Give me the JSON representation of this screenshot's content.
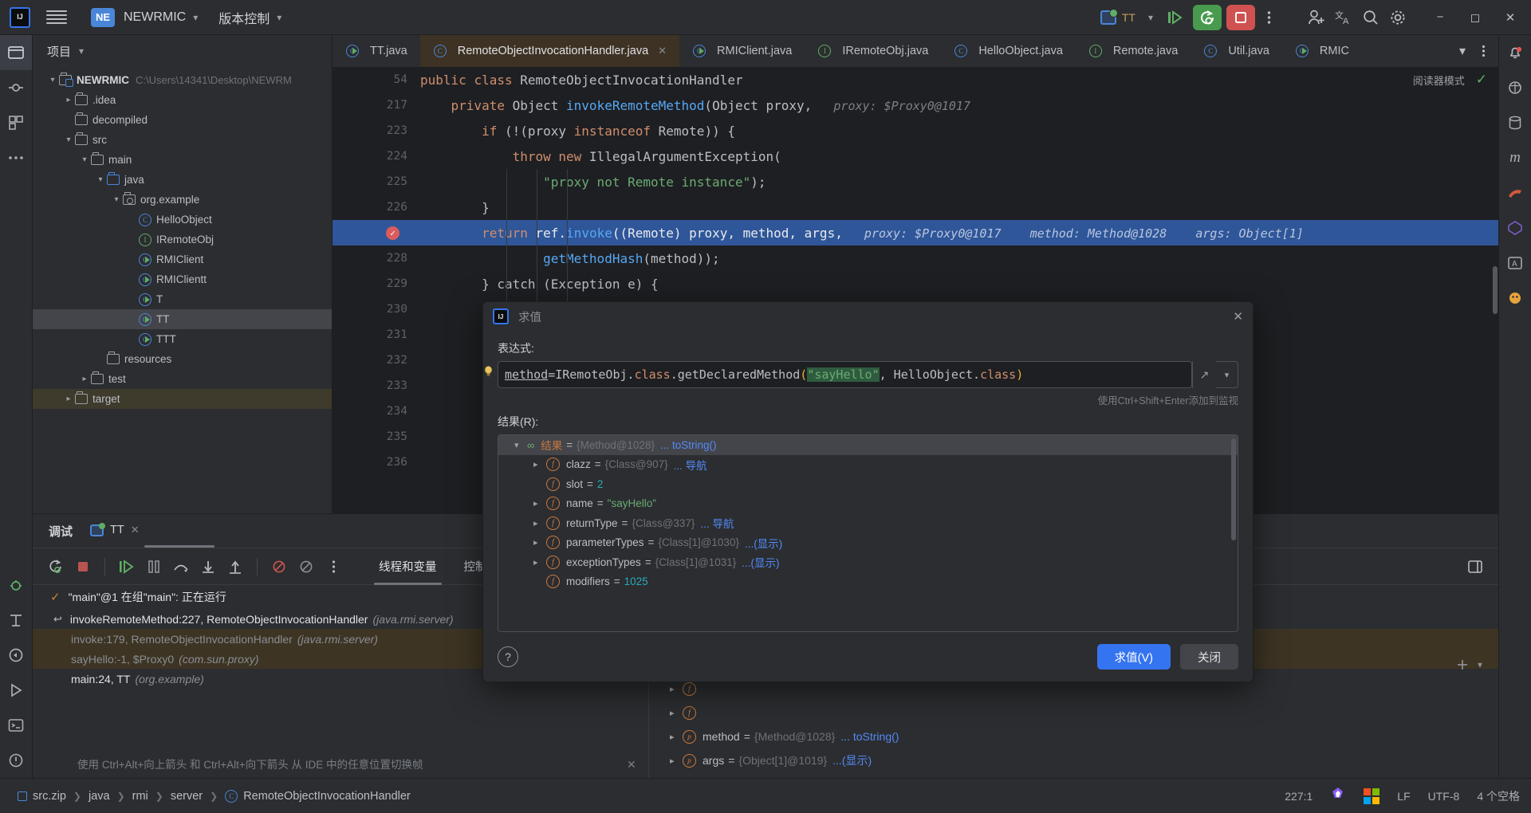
{
  "titlebar": {
    "logo": "IJ",
    "menu_icon": "hamburger-icon",
    "project_badge": "NE",
    "project_name": "NEWRMIC",
    "vcs_label": "版本控制",
    "run_config": "TT",
    "icons": [
      "run-icon",
      "debug-icon",
      "stop-icon",
      "more-icon",
      "add-user-icon",
      "translate-icon",
      "search-icon",
      "settings-icon"
    ],
    "window_buttons": [
      "minimize",
      "maximize",
      "close"
    ]
  },
  "project_panel": {
    "title": "项目",
    "tree": [
      {
        "depth": 0,
        "arrow": "v",
        "icon": "module-folder-icon",
        "label": "NEWRMIC",
        "bold": true,
        "path": "C:\\Users\\14341\\Desktop\\NEWRM",
        "state": "normal"
      },
      {
        "depth": 1,
        "arrow": ">",
        "icon": "folder-icon",
        "label": ".idea",
        "state": "normal"
      },
      {
        "depth": 1,
        "arrow": "",
        "icon": "folder-icon",
        "label": "decompiled",
        "state": "normal"
      },
      {
        "depth": 1,
        "arrow": "v",
        "icon": "folder-icon",
        "label": "src",
        "state": "normal"
      },
      {
        "depth": 2,
        "arrow": "v",
        "icon": "folder-icon",
        "label": "main",
        "state": "normal"
      },
      {
        "depth": 3,
        "arrow": "v",
        "icon": "source-folder-icon",
        "label": "java",
        "state": "normal"
      },
      {
        "depth": 4,
        "arrow": "v",
        "icon": "package-icon",
        "label": "org.example",
        "state": "normal"
      },
      {
        "depth": 5,
        "arrow": "",
        "icon": "class-icon",
        "label": "HelloObject",
        "state": "normal"
      },
      {
        "depth": 5,
        "arrow": "",
        "icon": "interface-icon",
        "label": "IRemoteObj",
        "state": "normal"
      },
      {
        "depth": 5,
        "arrow": "",
        "icon": "runnable-class-icon",
        "label": "RMIClient",
        "state": "normal"
      },
      {
        "depth": 5,
        "arrow": "",
        "icon": "runnable-class-icon",
        "label": "RMIClientt",
        "state": "normal"
      },
      {
        "depth": 5,
        "arrow": "",
        "icon": "runnable-class-icon",
        "label": "T",
        "state": "normal"
      },
      {
        "depth": 5,
        "arrow": "",
        "icon": "runnable-class-icon",
        "label": "TT",
        "state": "selected"
      },
      {
        "depth": 5,
        "arrow": "",
        "icon": "runnable-class-icon",
        "label": "TTT",
        "state": "normal"
      },
      {
        "depth": 3,
        "arrow": "",
        "icon": "folder-icon",
        "label": "resources",
        "state": "normal"
      },
      {
        "depth": 2,
        "arrow": ">",
        "icon": "folder-icon",
        "label": "test",
        "state": "normal"
      },
      {
        "depth": 1,
        "arrow": ">",
        "icon": "folder-icon",
        "label": "target",
        "state": "highlight"
      }
    ]
  },
  "editor": {
    "tabs": [
      {
        "label": "TT.java",
        "icon": "runnable-class-icon",
        "active": false,
        "closable": false
      },
      {
        "label": "RemoteObjectInvocationHandler.java",
        "icon": "class-icon",
        "active": true,
        "closable": true
      },
      {
        "label": "RMIClient.java",
        "icon": "runnable-class-icon",
        "active": false,
        "closable": false
      },
      {
        "label": "IRemoteObj.java",
        "icon": "interface-icon",
        "active": false,
        "closable": false
      },
      {
        "label": "HelloObject.java",
        "icon": "class-icon",
        "active": false,
        "closable": false
      },
      {
        "label": "Remote.java",
        "icon": "interface-icon",
        "active": false,
        "closable": false
      },
      {
        "label": "Util.java",
        "icon": "class-icon",
        "active": false,
        "closable": false
      },
      {
        "label": "RMIC",
        "icon": "runnable-class-icon",
        "active": false,
        "closable": false
      }
    ],
    "reader_mode_label": "阅读器模式",
    "lines": [
      {
        "num": "54",
        "breakpoint": false,
        "highlight": false,
        "indent": 0,
        "tokens": [
          {
            "t": "public ",
            "c": "kw"
          },
          {
            "t": "class ",
            "c": "kw"
          },
          {
            "t": "RemoteObjectInvocationHandler",
            "c": "txt"
          }
        ]
      },
      {
        "num": "217",
        "breakpoint": false,
        "highlight": false,
        "indent": 1,
        "tokens": [
          {
            "t": "private ",
            "c": "kw"
          },
          {
            "t": "Object ",
            "c": "txt"
          },
          {
            "t": "invokeRemoteMethod",
            "c": "fn"
          },
          {
            "t": "(",
            "c": "pun"
          },
          {
            "t": "Object proxy,",
            "c": "txt"
          },
          {
            "t": "   proxy: $Proxy0@1017",
            "c": "hint"
          }
        ]
      },
      {
        "num": "223",
        "breakpoint": false,
        "highlight": false,
        "indent": 2,
        "tokens": [
          {
            "t": "if ",
            "c": "kw"
          },
          {
            "t": "(!(",
            "c": "pun"
          },
          {
            "t": "proxy ",
            "c": "txt"
          },
          {
            "t": "instanceof ",
            "c": "kw"
          },
          {
            "t": "Remote",
            "c": "txt"
          },
          {
            "t": ")) {",
            "c": "pun"
          }
        ]
      },
      {
        "num": "224",
        "breakpoint": false,
        "highlight": false,
        "indent": 3,
        "tokens": [
          {
            "t": "throw ",
            "c": "kw"
          },
          {
            "t": "new ",
            "c": "kw"
          },
          {
            "t": "IllegalArgumentException",
            "c": "txt"
          },
          {
            "t": "(",
            "c": "pun"
          }
        ]
      },
      {
        "num": "225",
        "breakpoint": false,
        "highlight": false,
        "indent": 4,
        "tokens": [
          {
            "t": "\"proxy not Remote instance\"",
            "c": "str"
          },
          {
            "t": ");",
            "c": "pun"
          }
        ]
      },
      {
        "num": "226",
        "breakpoint": false,
        "highlight": false,
        "indent": 2,
        "tokens": [
          {
            "t": "}",
            "c": "pun"
          }
        ]
      },
      {
        "num": "227",
        "breakpoint": true,
        "highlight": true,
        "indent": 2,
        "tokens": [
          {
            "t": "return ",
            "c": "kw"
          },
          {
            "t": "ref",
            "c": "txt"
          },
          {
            "t": ".",
            "c": "pun"
          },
          {
            "t": "invoke",
            "c": "fn"
          },
          {
            "t": "((",
            "c": "pun"
          },
          {
            "t": "Remote",
            "c": "txt"
          },
          {
            "t": ") proxy, method, args,",
            "c": "pun"
          },
          {
            "t": "   proxy: $Proxy0@1017",
            "c": "hint"
          },
          {
            "t": "    method: Method@1028",
            "c": "hint"
          },
          {
            "t": "    args: Object[1]",
            "c": "hint"
          }
        ]
      },
      {
        "num": "228",
        "breakpoint": false,
        "highlight": false,
        "indent": 4,
        "tokens": [
          {
            "t": "getMethodHash",
            "c": "fn"
          },
          {
            "t": "(method));",
            "c": "pun"
          }
        ]
      },
      {
        "num": "229",
        "breakpoint": false,
        "highlight": false,
        "indent": 2,
        "tokens": [
          {
            "t": "} catch (Exception e) {",
            "c": "pun"
          }
        ]
      },
      {
        "num": "230",
        "breakpoint": false,
        "highlight": false,
        "indent": 0,
        "tokens": []
      },
      {
        "num": "231",
        "breakpoint": false,
        "highlight": false,
        "indent": 0,
        "tokens": []
      },
      {
        "num": "232",
        "breakpoint": false,
        "highlight": false,
        "indent": 0,
        "tokens": []
      },
      {
        "num": "233",
        "breakpoint": false,
        "highlight": false,
        "indent": 0,
        "tokens": []
      },
      {
        "num": "234",
        "breakpoint": false,
        "highlight": false,
        "indent": 0,
        "tokens": []
      },
      {
        "num": "235",
        "breakpoint": false,
        "highlight": false,
        "indent": 0,
        "tokens": []
      },
      {
        "num": "236",
        "breakpoint": false,
        "highlight": false,
        "indent": 0,
        "tokens": []
      }
    ]
  },
  "debug": {
    "title": "调试",
    "session_tab": "TT",
    "toolbar_icons": [
      "rerun-icon",
      "stop-icon",
      "resume-icon",
      "pause-icon",
      "step-over-icon",
      "step-into-icon",
      "step-out-icon",
      "mute-breakpoints-icon",
      "view-breakpoints-icon",
      "more-icon"
    ],
    "subtabs": [
      {
        "label": "线程和变量",
        "active": true
      },
      {
        "label": "控制台",
        "active": false
      }
    ],
    "thread_status": "\"main\"@1 在组\"main\": 正在运行",
    "frames": [
      {
        "label": "invokeRemoteMethod:227, RemoteObjectInvocationHandler",
        "pkg": "(java.rmi.server)",
        "state": "selected"
      },
      {
        "label": "invoke:179, RemoteObjectInvocationHandler",
        "pkg": "(java.rmi.server)",
        "state": "dim"
      },
      {
        "label": "sayHello:-1, $Proxy0",
        "pkg": "(com.sun.proxy)",
        "state": "dim"
      },
      {
        "label": "main:24, TT",
        "pkg": "(org.example)",
        "state": "plain"
      }
    ],
    "hint": "使用 Ctrl+Alt+向上箭头 和 Ctrl+Alt+向下箭头 从 IDE 中的任意位置切换帧",
    "variables": [
      {
        "chev": ">",
        "icon": "p",
        "name": "method",
        "eq": "=",
        "val": "{Method@1028}",
        "extra": "... toString()",
        "extra_class": "vlink"
      },
      {
        "chev": ">",
        "icon": "p",
        "name": "args",
        "eq": "=",
        "val": "{Object[1]@1019}",
        "extra": "...(显示)",
        "extra_class": "vlink"
      }
    ]
  },
  "dialog": {
    "title": "求值",
    "expr_label": "表达式:",
    "expression_parts": [
      {
        "t": "method",
        "c": "u"
      },
      {
        "t": "=",
        "c": "pun"
      },
      {
        "t": "IRemoteObj",
        "c": "txt"
      },
      {
        "t": ".",
        "c": "pun"
      },
      {
        "t": "class",
        "c": "kw"
      },
      {
        "t": ".",
        "c": "pun"
      },
      {
        "t": "getDeclaredMethod",
        "c": "txt"
      },
      {
        "t": "(",
        "c": "pun2"
      },
      {
        "t": "\"sayHello\"",
        "c": "selstr"
      },
      {
        "t": ", HelloObject",
        "c": "txt"
      },
      {
        "t": ".",
        "c": "pun"
      },
      {
        "t": "class",
        "c": "kw"
      },
      {
        "t": ")",
        "c": "pun2"
      }
    ],
    "expression_plain": "method=IRemoteObj.class.getDeclaredMethod(\"sayHello\", HelloObject.class)",
    "watch_hint": "使用Ctrl+Shift+Enter添加到监视",
    "result_label": "结果(R):",
    "result_rows": [
      {
        "indent": 0,
        "chev": "v",
        "icon": "result-icon",
        "name": "结果",
        "eq": "=",
        "val": "{Method@1028}",
        "extra": "... toString()",
        "extra_class": "vlink",
        "selected": true
      },
      {
        "indent": 1,
        "chev": ">",
        "icon": "f",
        "name": "clazz",
        "eq": "=",
        "val": "{Class@907}",
        "extra": "... 导航",
        "extra_class": "vlink",
        "selected": false
      },
      {
        "indent": 1,
        "chev": "",
        "icon": "f",
        "name": "slot",
        "eq": "=",
        "val": "2",
        "extra": "",
        "extra_class": "vnum",
        "selected": false,
        "val_class": "vnum"
      },
      {
        "indent": 1,
        "chev": ">",
        "icon": "f",
        "name": "name",
        "eq": "=",
        "val": "\"sayHello\"",
        "extra": "",
        "extra_class": "",
        "selected": false,
        "val_class": "vstr"
      },
      {
        "indent": 1,
        "chev": ">",
        "icon": "f",
        "name": "returnType",
        "eq": "=",
        "val": "{Class@337}",
        "extra": "... 导航",
        "extra_class": "vlink",
        "selected": false
      },
      {
        "indent": 1,
        "chev": ">",
        "icon": "f",
        "name": "parameterTypes",
        "eq": "=",
        "val": "{Class[1]@1030}",
        "extra": "...(显示)",
        "extra_class": "vlink",
        "selected": false
      },
      {
        "indent": 1,
        "chev": ">",
        "icon": "f",
        "name": "exceptionTypes",
        "eq": "=",
        "val": "{Class[1]@1031}",
        "extra": "...(显示)",
        "extra_class": "vlink",
        "selected": false
      },
      {
        "indent": 1,
        "chev": "",
        "icon": "f",
        "name": "modifiers",
        "eq": "=",
        "val": "1025",
        "extra": "",
        "extra_class": "",
        "selected": false,
        "val_class": "vnum"
      }
    ],
    "help_label": "?",
    "evaluate_button": "求值(V)",
    "close_button": "关闭"
  },
  "statusbar": {
    "breadcrumbs": [
      "src.zip",
      "java",
      "rmi",
      "server",
      "RemoteObjectInvocationHandler"
    ],
    "caret": "227:1",
    "line_sep": "LF",
    "encoding": "UTF-8",
    "indent": "4 个空格"
  },
  "colors": {
    "accent_blue": "#3574f0",
    "run_green": "#479a4e",
    "stop_red": "#cf5250",
    "highlight_line": "#2f5699",
    "panel_bg": "#2b2d30",
    "editor_bg": "#1e1f22",
    "active_tab_bg": "#3d3223"
  }
}
